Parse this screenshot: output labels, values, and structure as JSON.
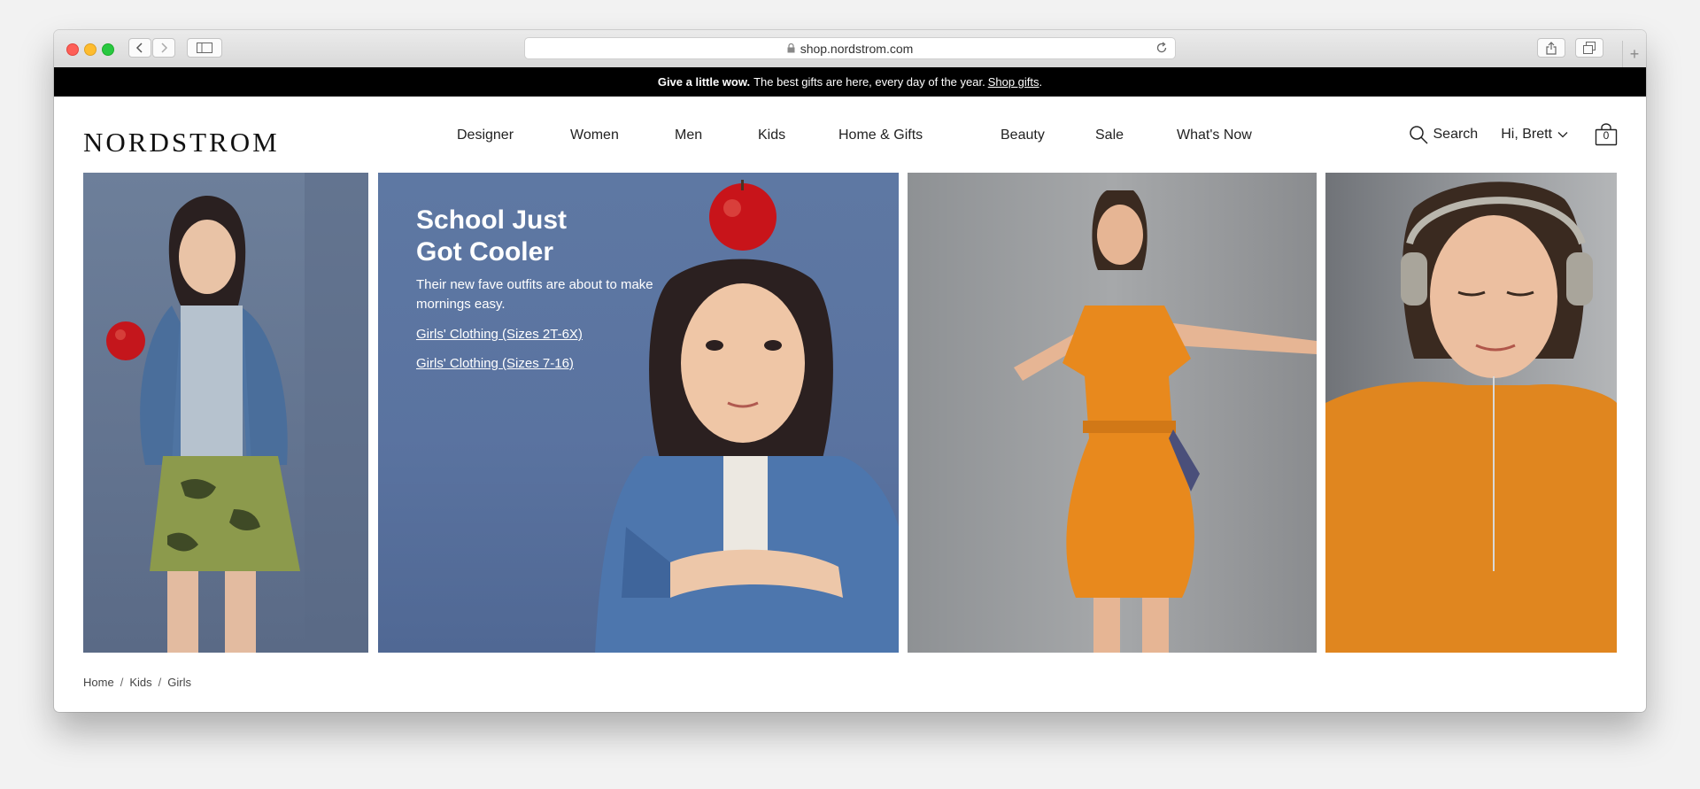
{
  "browser": {
    "url": "shop.nordstrom.com",
    "new_tab_glyph": "+"
  },
  "promo": {
    "bold": "Give a little wow.",
    "text": "The best gifts are here, every day of the year.",
    "link": "Shop gifts",
    "end": "."
  },
  "header": {
    "logo": "NORDSTROM",
    "nav": [
      "Designer",
      "Women",
      "Men",
      "Kids",
      "Home & Gifts",
      "Beauty",
      "Sale",
      "What's Now"
    ],
    "search_label": "Search",
    "account_label": "Hi, Brett",
    "bag_count": "0"
  },
  "hero": {
    "title_line1": "School Just",
    "title_line2": "Got Cooler",
    "subtitle": "Their new fave outfits are about to make mornings easy.",
    "links": [
      "Girls' Clothing (Sizes 2T-6X)",
      "Girls' Clothing (Sizes 7-16)"
    ]
  },
  "breadcrumb": {
    "items": [
      "Home",
      "Kids",
      "Girls"
    ],
    "separator": "/"
  },
  "colors": {
    "promo_bg": "#000000",
    "hero_blue": "#5a73a0",
    "orange_dress": "#e8891d"
  }
}
